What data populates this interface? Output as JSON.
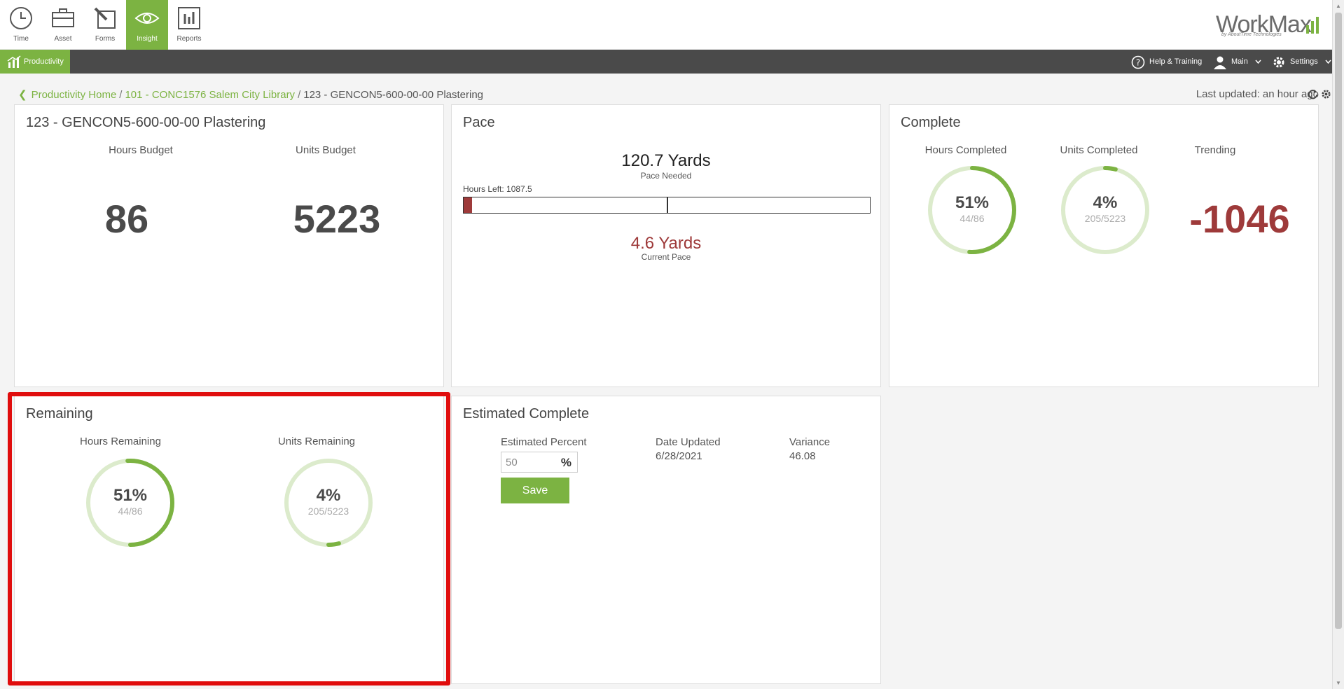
{
  "apps": [
    {
      "label": "Time",
      "icon": "clock-icon"
    },
    {
      "label": "Asset",
      "icon": "briefcase-icon"
    },
    {
      "label": "Forms",
      "icon": "pencil-icon"
    },
    {
      "label": "Insight",
      "icon": "eye-icon",
      "active": true
    },
    {
      "label": "Reports",
      "icon": "chart-icon"
    }
  ],
  "logo": {
    "text": "WorkMax",
    "sub": "by AboutTime Technologies"
  },
  "nav": {
    "productivity": "Productivity",
    "help": "Help & Training",
    "user": "Main",
    "settings": "Settings"
  },
  "breadcrumb": {
    "home": "Productivity Home",
    "project": "101 - CONC1576 Salem City Library",
    "current": "123 - GENCON5-600-00-00 Plastering",
    "sep": "/"
  },
  "last_updated": "Last updated: an hour ago",
  "budget_card": {
    "title": "123 - GENCON5-600-00-00 Plastering",
    "hours_label": "Hours Budget",
    "hours_value": "86",
    "units_label": "Units Budget",
    "units_value": "5223"
  },
  "pace_card": {
    "title": "Pace",
    "needed_value": "120.7 Yards",
    "needed_label": "Pace Needed",
    "hours_left": "Hours Left: 1087.5",
    "current_value": "4.6 Yards",
    "current_label": "Current Pace",
    "progress_fraction": 0.02
  },
  "complete_card": {
    "title": "Complete",
    "hours_label": "Hours Completed",
    "hours_pct": "51%",
    "hours_frac": "44/86",
    "hours_value": 0.51,
    "units_label": "Units Completed",
    "units_pct": "4%",
    "units_frac": "205/5223",
    "units_value": 0.04,
    "trending_label": "Trending",
    "trending_value": "-1046"
  },
  "remaining_card": {
    "title": "Remaining",
    "hours_label": "Hours Remaining",
    "hours_pct": "51%",
    "hours_frac": "44/86",
    "hours_value": 0.51,
    "units_label": "Units Remaining",
    "units_pct": "4%",
    "units_frac": "205/5223",
    "units_value": 0.04
  },
  "estimated_card": {
    "title": "Estimated Complete",
    "percent_label": "Estimated Percent",
    "percent_value": "50",
    "percent_unit": "%",
    "date_label": "Date Updated",
    "date_value": "6/28/2021",
    "variance_label": "Variance",
    "variance_value": "46.08",
    "save_label": "Save"
  },
  "colors": {
    "accent": "#7cb342",
    "ring_bg": "#dcebcc",
    "danger": "#9e3a3a",
    "highlight": "#e00d0d"
  }
}
